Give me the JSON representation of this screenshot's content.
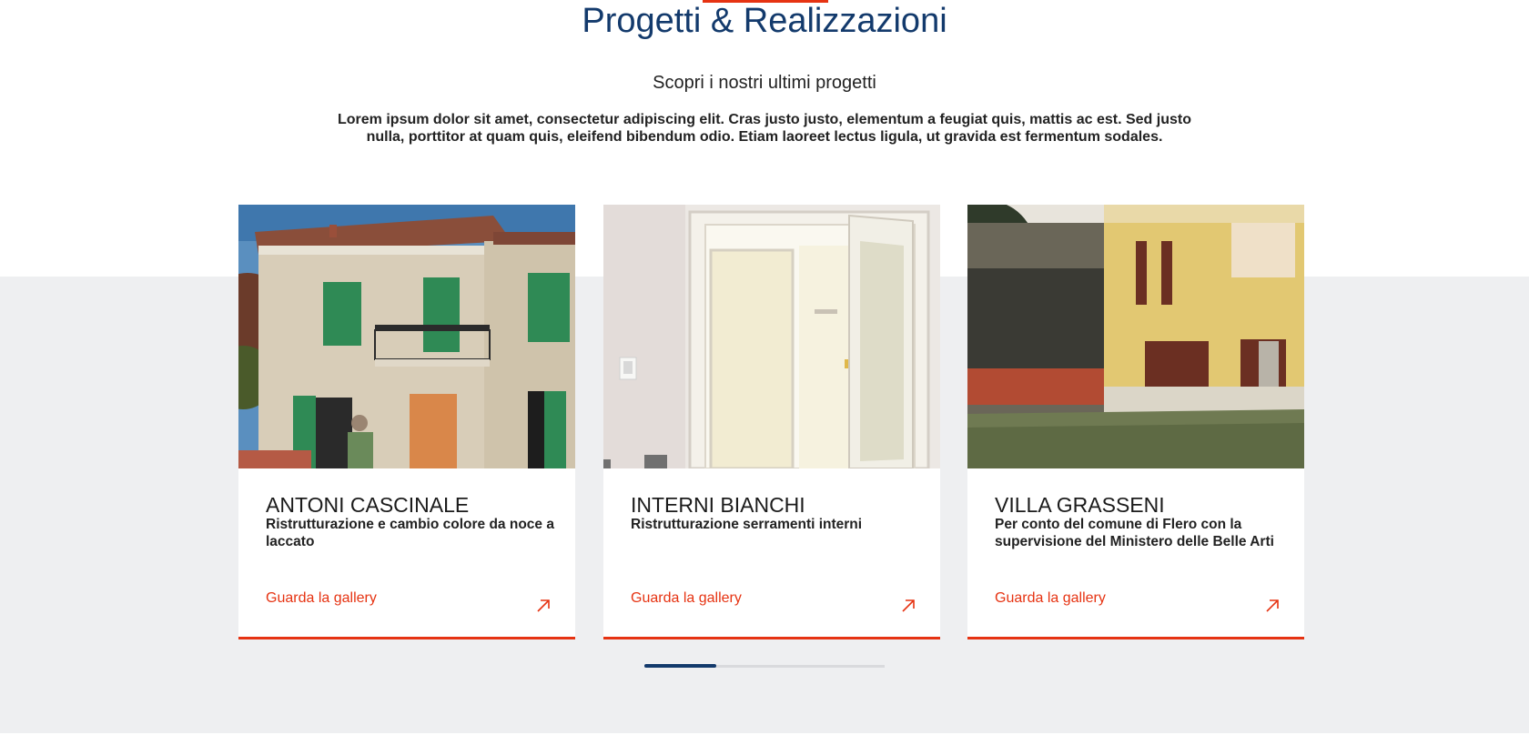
{
  "section": {
    "title": "Progetti & Realizzazioni",
    "subtitle": "Scopri i nostri ultimi progetti",
    "intro": "Lorem ipsum dolor sit amet, consectetur adipiscing elit. Cras justo justo, elementum a feugiat quis, mattis ac est. Sed justo nulla, porttitor at quam quis, eleifend bibendum odio. Etiam laoreet lectus ligula, ut gravida est fermentum sodales."
  },
  "cards": [
    {
      "title": "ANTONI CASCINALE",
      "description": "Ristrutturazione e cambio colore da noce a laccato",
      "link_label": "Guarda la gallery",
      "image": "stone-house-green-shutters-photo",
      "icon": "arrow-up-right-icon"
    },
    {
      "title": "INTERNI BIANCHI",
      "description": "Ristrutturazione serramenti interni",
      "link_label": "Guarda la gallery",
      "image": "white-interior-door-photo",
      "icon": "arrow-up-right-icon"
    },
    {
      "title": "VILLA GRASSENI",
      "description": "Per conto del comune di Flero con la supervisione del Ministero delle Belle Arti",
      "link_label": "Guarda la gallery",
      "image": "yellow-villa-brown-shutters-photo",
      "icon": "arrow-up-right-icon"
    }
  ],
  "pager": {
    "position_fraction": 0.3
  },
  "colors": {
    "accent": "#e63312",
    "title_blue": "#133a6c",
    "band_gray": "#eeeff1"
  }
}
